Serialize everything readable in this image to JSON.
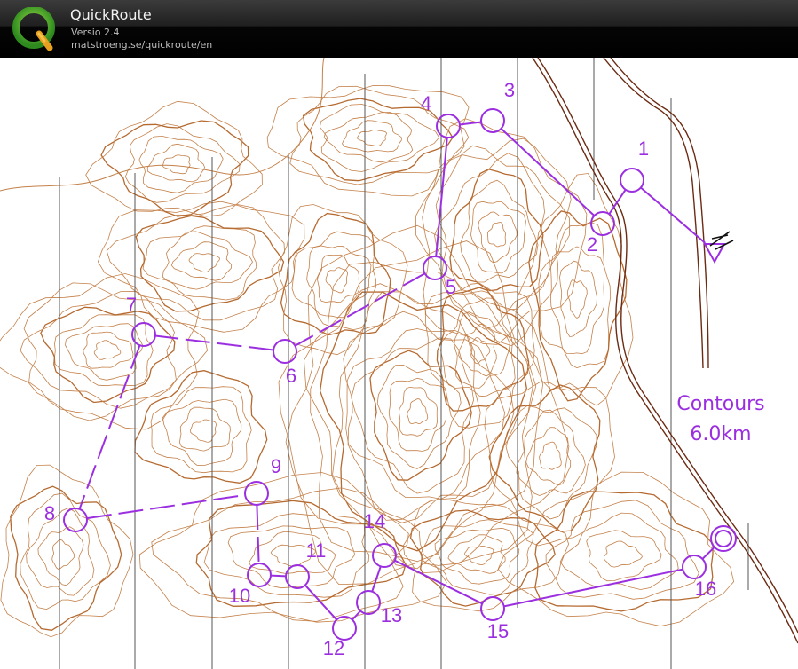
{
  "app": {
    "title": "QuickRoute",
    "version": "Versio 2.4",
    "url": "matstroeng.se/quickroute/en",
    "logo_letter": "Q"
  },
  "map": {
    "type": "orienteering-map",
    "legend_course_type": "Contours",
    "legend_course_length": "6.0km",
    "colors": {
      "contours": "#c4814a",
      "contours_index": "#b56a30",
      "course": "#9b2fe0",
      "road": "#6b2a12",
      "north_lines": "#555555"
    },
    "controls": [
      {
        "id": "start",
        "label": ""
      },
      {
        "id": "c1",
        "label": "1"
      },
      {
        "id": "c2",
        "label": "2"
      },
      {
        "id": "c3",
        "label": "3"
      },
      {
        "id": "c4",
        "label": "4"
      },
      {
        "id": "c5",
        "label": "5"
      },
      {
        "id": "c6",
        "label": "6"
      },
      {
        "id": "c7",
        "label": "7"
      },
      {
        "id": "c8",
        "label": "8"
      },
      {
        "id": "c9",
        "label": "9"
      },
      {
        "id": "c10",
        "label": "10"
      },
      {
        "id": "c11",
        "label": "11"
      },
      {
        "id": "c12",
        "label": "12"
      },
      {
        "id": "c13",
        "label": "13"
      },
      {
        "id": "c14",
        "label": "14"
      },
      {
        "id": "c15",
        "label": "15"
      },
      {
        "id": "c16",
        "label": "16"
      },
      {
        "id": "finish",
        "label": ""
      }
    ]
  }
}
